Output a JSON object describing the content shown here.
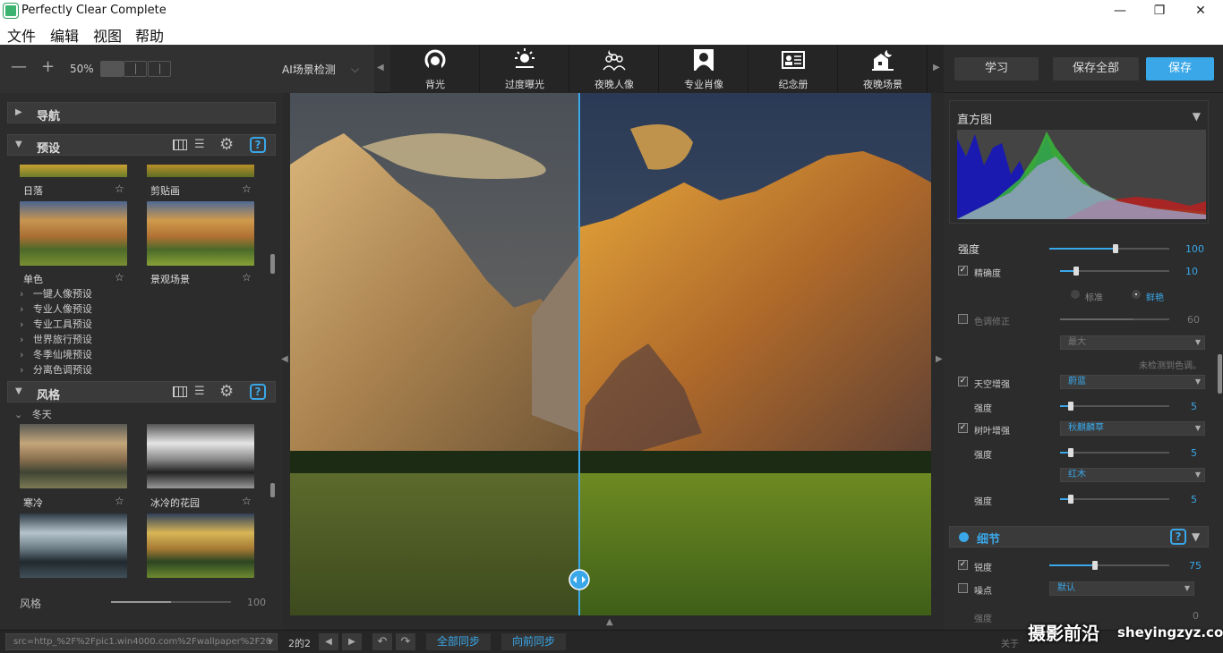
{
  "window": {
    "title": "Perfectly Clear Complete",
    "minimize": "—",
    "maximize": "❐",
    "close": "✕"
  },
  "menu": [
    "文件",
    "编辑",
    "视图",
    "帮助"
  ],
  "toolbar": {
    "zoom_out": "—",
    "zoom_in": "+",
    "zoom": "50%",
    "ai_label": "AI场景检测"
  },
  "scenes": [
    "背光",
    "过度曝光",
    "夜晚人像",
    "专业肖像",
    "纪念册",
    "夜晚场景"
  ],
  "top_buttons": {
    "learn": "学习",
    "save_all": "保存全部",
    "save": "保存"
  },
  "left": {
    "nav": "导航",
    "presets": {
      "title": "预设",
      "help": "?",
      "thumbs": [
        {
          "label": "日落"
        },
        {
          "label": "剪贴画"
        },
        {
          "label": "单色"
        },
        {
          "label": "景观场景"
        }
      ],
      "items": [
        "一键人像预设",
        "专业人像预设",
        "专业工具预设",
        "世界旅行预设",
        "冬季仙境预设",
        "分离色调预设"
      ]
    },
    "styles": {
      "title": "风格",
      "help": "?",
      "group": "冬天",
      "thumbs": [
        {
          "label": "寒冷"
        },
        {
          "label": "冰冷的花园"
        }
      ],
      "footer_label": "风格",
      "footer_value": "100",
      "footer_fraction": 0.5
    }
  },
  "right": {
    "histogram_title": "直方图",
    "strength": {
      "label": "强度",
      "value": "100",
      "fraction": 0.55
    },
    "vibrancy": {
      "label": "精确度",
      "value": "10",
      "fraction": 0.15
    },
    "mode_standard": "标准",
    "mode_vivid": "鲜艳",
    "tint": {
      "label": "色调修正",
      "value": "60",
      "fraction": 0.67,
      "dropdown": "最大",
      "note": "未检测到色调。"
    },
    "sky": {
      "label": "天空增强",
      "dropdown": "蔚蓝",
      "strength_label": "强度",
      "value": "5",
      "fraction": 0.1
    },
    "foliage": {
      "label": "树叶增强",
      "dropdown": "秋麒麟草",
      "strength_label": "强度",
      "value": "5",
      "fraction": 0.1,
      "dropdown2": "红木",
      "strength2_label": "强度",
      "value2": "5",
      "fraction2": 0.1
    },
    "detail": {
      "title": "细节",
      "help": "?",
      "sharpen_label": "锐度",
      "sharpen_value": "75",
      "sharpen_fraction": 0.38,
      "noise_label": "噪点",
      "noise_dropdown": "默认",
      "noise_strength_label": "强度",
      "noise_value": "0"
    }
  },
  "status": {
    "path": "src=http_%2F%2Fpic1.win4000.com%2Fwallpaper%2F20",
    "count": "2的2",
    "sync_all": "全部同步",
    "sync_forward": "向前同步",
    "about": "关于"
  },
  "watermark": {
    "cn": "摄影前沿",
    "url": "sheyingzyz.com"
  },
  "colors": {
    "accent": "#3aa7e8"
  }
}
